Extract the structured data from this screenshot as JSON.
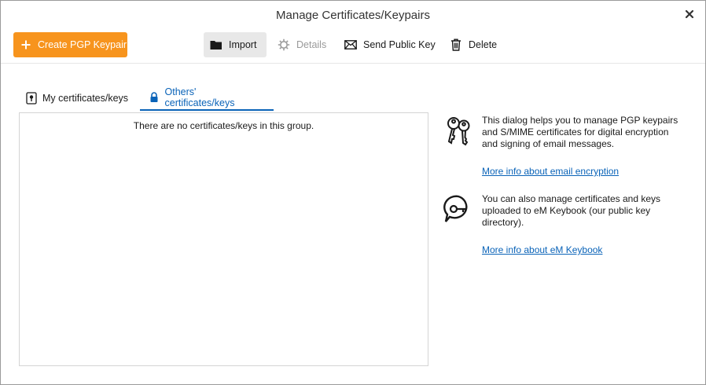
{
  "window": {
    "title": "Manage Certificates/Keypairs"
  },
  "toolbar": {
    "create_label": "Create PGP Keypair",
    "import_label": "Import",
    "details_label": "Details",
    "send_label": "Send Public Key",
    "delete_label": "Delete"
  },
  "tabs": [
    {
      "label": "My certificates/keys",
      "icon": "certificate-icon",
      "active": false
    },
    {
      "label": "Others' certificates/keys",
      "icon": "lock-icon",
      "active": true
    }
  ],
  "list": {
    "empty_message": "There are no certificates/keys in this group."
  },
  "info": {
    "encryption_text": "This dialog helps you to manage PGP keypairs and S/MIME certificates for digital encryption and signing of email messages.",
    "encryption_link": "More info about email encryption",
    "keybook_text": "You can also manage certificates and keys uploaded to eM Keybook (our public key directory).",
    "keybook_link": "More info about eM Keybook"
  },
  "colors": {
    "accent": "#f7941d",
    "link": "#0a63b8",
    "active_tab": "#0a63b8"
  }
}
